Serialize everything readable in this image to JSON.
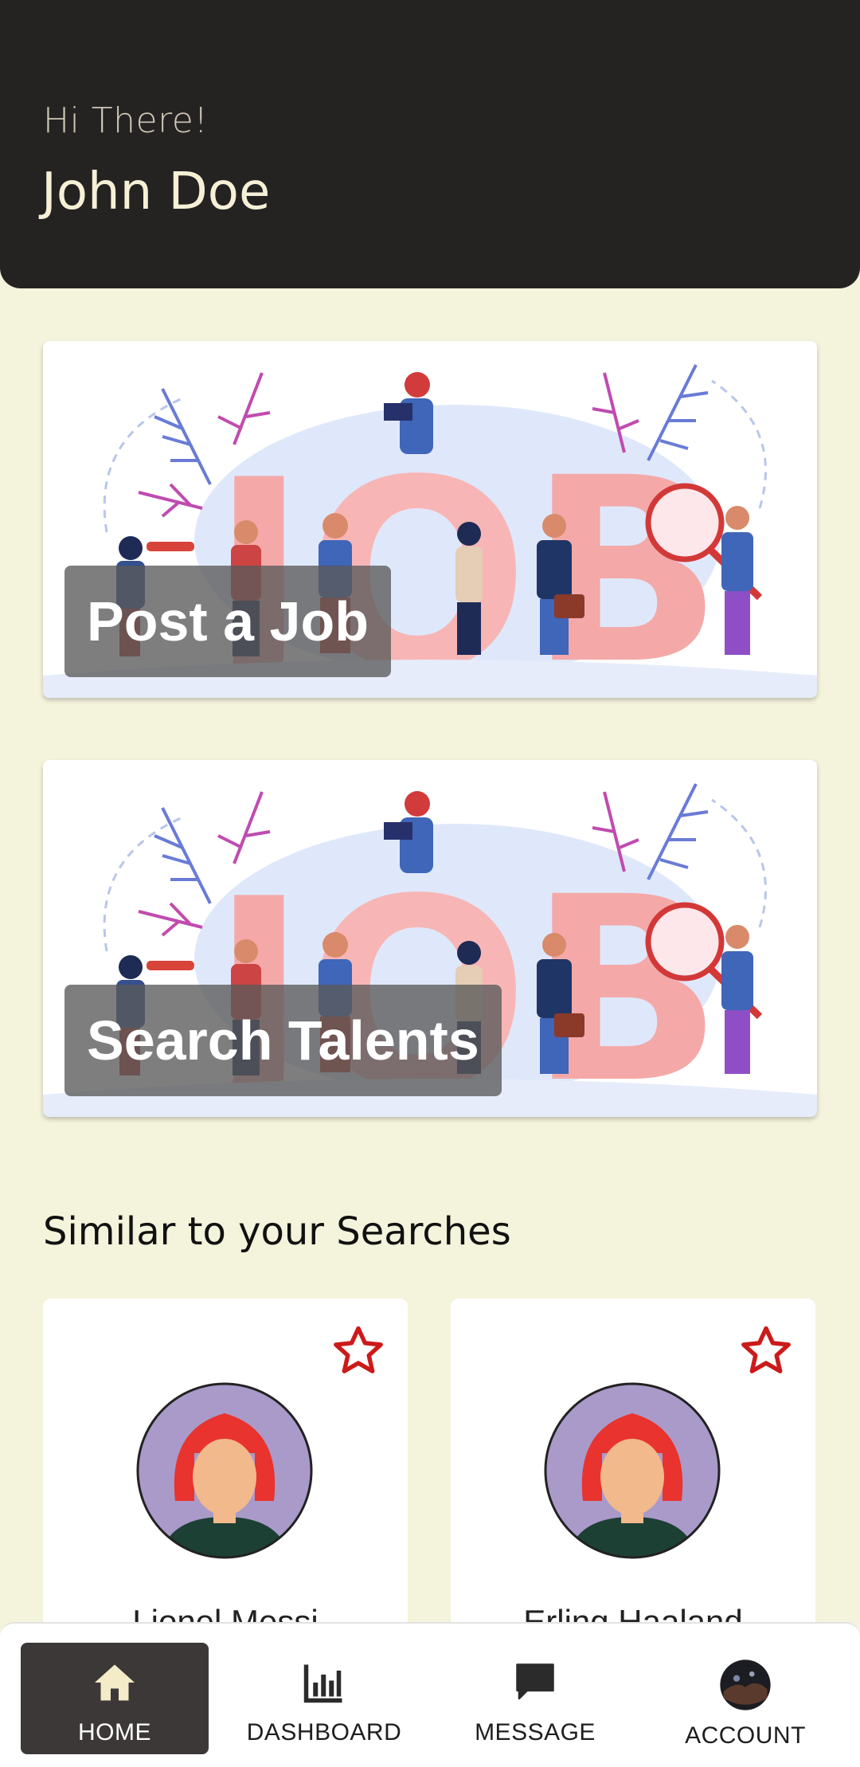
{
  "header": {
    "greeting": "Hi There!",
    "user_name": "John Doe"
  },
  "cards": [
    {
      "label": "Post a Job",
      "illustration_text": "JOB"
    },
    {
      "label": "Search Talents",
      "illustration_text": "JOB"
    }
  ],
  "section": {
    "title": "Similar to your Searches"
  },
  "profiles": [
    {
      "name": "Lionel Messi",
      "icon": "star-outline-icon"
    },
    {
      "name": "Erling Haaland",
      "icon": "star-outline-icon"
    }
  ],
  "nav": {
    "items": [
      {
        "label": "HOME",
        "icon": "home-icon",
        "active": true
      },
      {
        "label": "DASHBOARD",
        "icon": "bar-chart-icon",
        "active": false
      },
      {
        "label": "MESSAGE",
        "icon": "message-icon",
        "active": false
      },
      {
        "label": "ACCOUNT",
        "icon": "avatar-icon",
        "active": false
      }
    ]
  },
  "colors": {
    "background": "#f4f3dc",
    "header": "#252222",
    "accent_red": "#cc1a1a",
    "nav_active": "#3d3838"
  }
}
